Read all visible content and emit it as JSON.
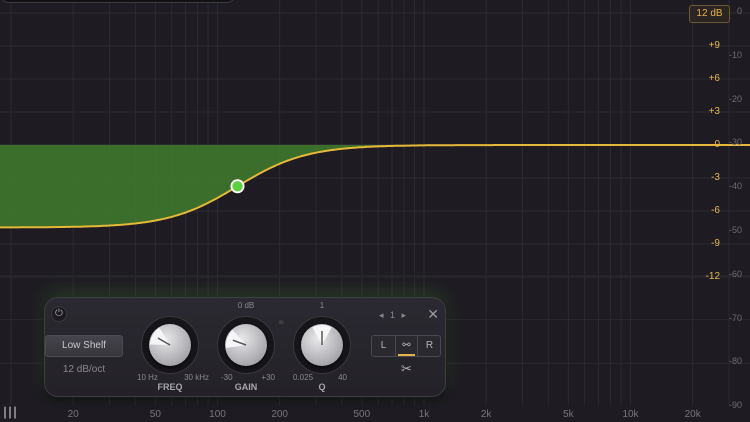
{
  "topbar": {
    "range_label": "12 dB"
  },
  "gain_scale": [
    "+9",
    "+6",
    "+3",
    "0",
    "-3",
    "-6",
    "-9",
    "-12"
  ],
  "analyzer_scale": [
    "0",
    "-10",
    "-20",
    "-30",
    "-40",
    "-50",
    "-60",
    "-70",
    "-80",
    "-90"
  ],
  "freq_scale": [
    "20",
    "50",
    "100",
    "200",
    "500",
    "1k",
    "2k",
    "5k",
    "10k",
    "20k"
  ],
  "band": {
    "shape": "Low Shelf",
    "slope": "12 dB/oct",
    "gain_db": -7.5,
    "freq_hz": 125,
    "freq_knob": {
      "min": "10 Hz",
      "max": "30 kHz",
      "label": "FREQ"
    },
    "gain_knob": {
      "min": "-30",
      "max": "+30",
      "label": "GAIN",
      "center": "0 dB"
    },
    "q_knob": {
      "min": "0.025",
      "max": "40",
      "label": "Q",
      "center": "1"
    },
    "nav_index": "1",
    "stereo": {
      "left": "L",
      "right": "R"
    }
  },
  "colors": {
    "curve": "#e5b83a",
    "fill": "#3f7d2c",
    "node": "#5fd040",
    "accent": "#e5b34a"
  },
  "icons": {
    "power": "power-icon",
    "close": "close-icon",
    "scissors": "scissors-icon",
    "link": "stereo-link-icon"
  }
}
